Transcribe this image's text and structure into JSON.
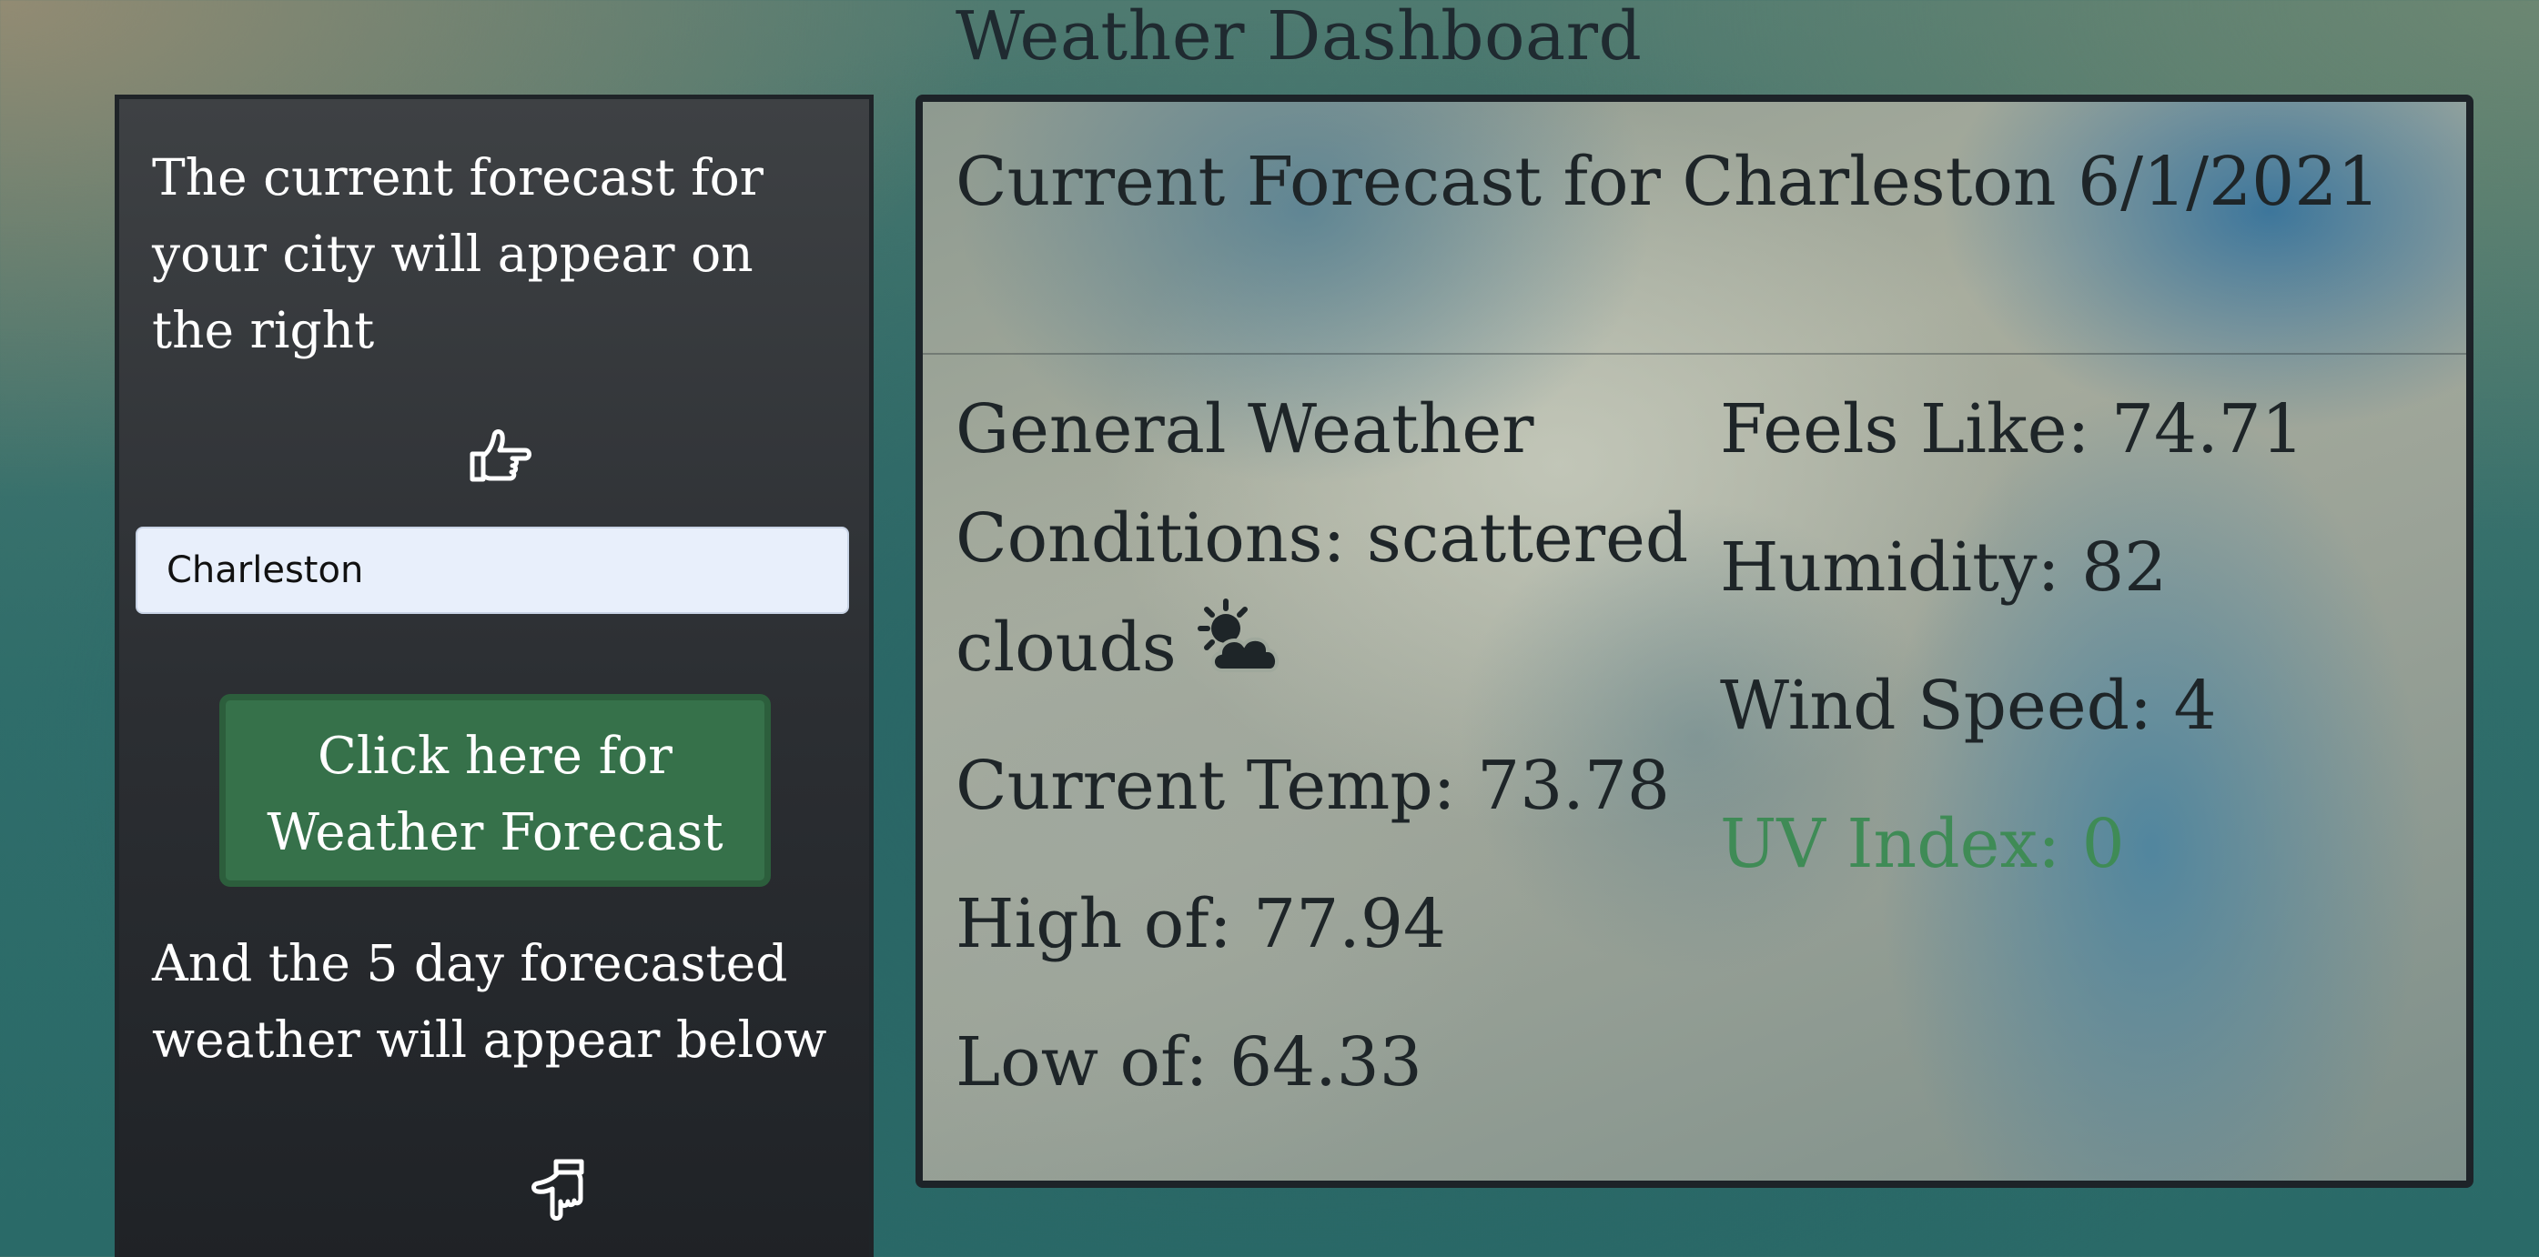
{
  "page": {
    "title": "Weather Dashboard"
  },
  "sidebar": {
    "intro_text": "The current forecast for your city will appear on the right",
    "city_input_value": "Charleston",
    "forecast_button_label": "Click here for Weather Forecast",
    "below_text": "And the 5 day forecasted weather will appear below",
    "icons": [
      "hand-pointing-right-icon",
      "hand-pointing-down-icon"
    ]
  },
  "forecast": {
    "title": "Current Forecast for Charleston 6/1/2021",
    "conditions": "General Weather Conditions: scattered clouds",
    "conditions_icon": "sun-behind-cloud-icon",
    "current_temp": "Current Temp: 73.78",
    "high": "High of: 77.94",
    "low": "Low of: 64.33",
    "feels_like": "Feels Like: 74.71",
    "humidity": "Humidity: 82",
    "wind_speed": "Wind Speed: 4",
    "uv_index": "UV Index: 0"
  },
  "colors": {
    "button_green": "#36714a",
    "uv_green": "#3f8b56",
    "sidebar_dark": "#2c2f33",
    "input_bg": "#e8effb"
  }
}
